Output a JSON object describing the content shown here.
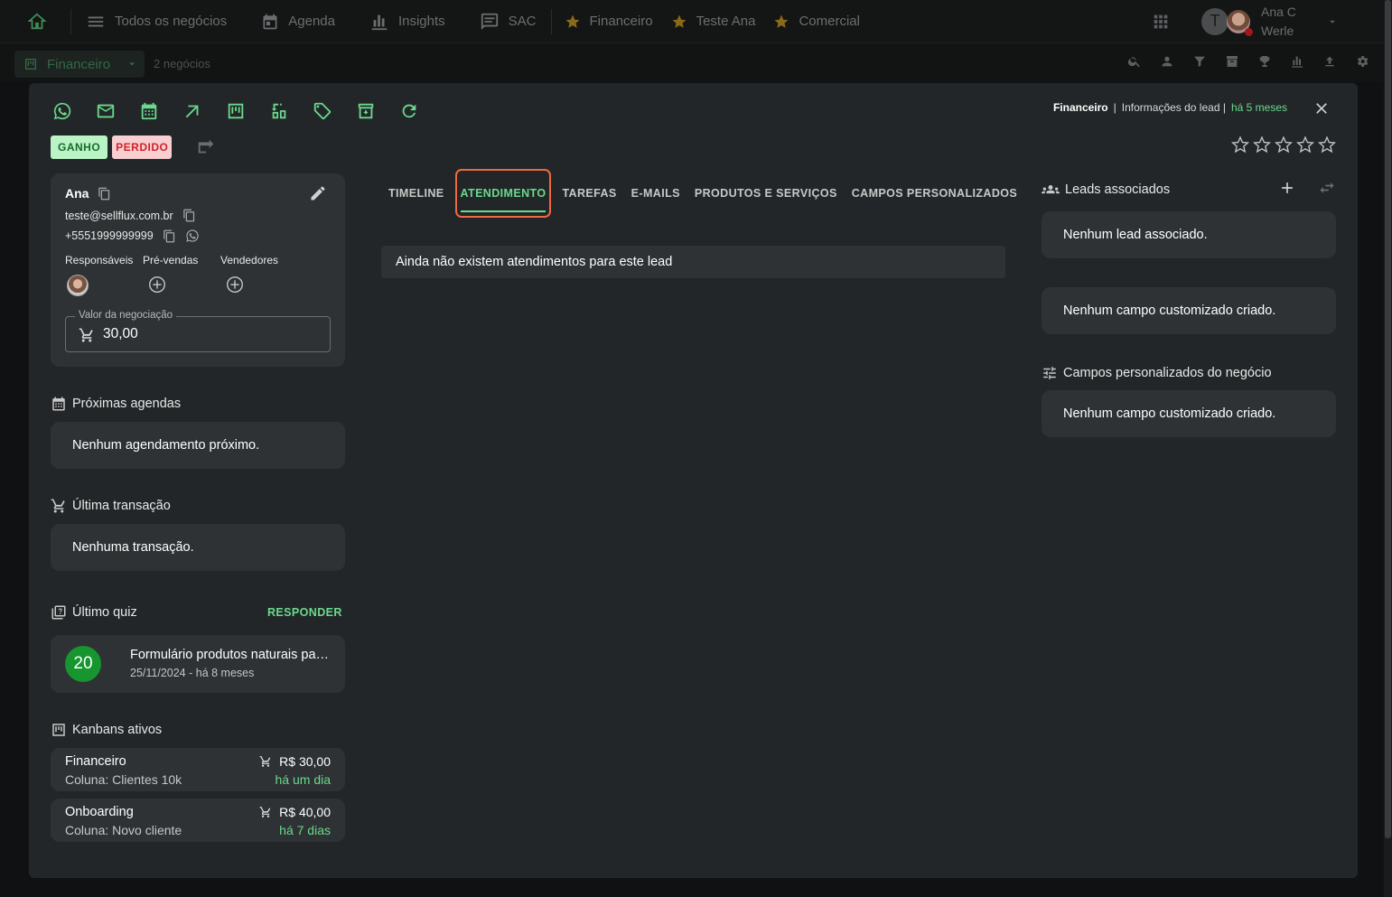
{
  "nav": {
    "items": [
      {
        "label": "Todos os negócios",
        "icon": "list-icon"
      },
      {
        "label": "Agenda",
        "icon": "calendar-icon"
      },
      {
        "label": "Insights",
        "icon": "bar-chart-icon"
      },
      {
        "label": "SAC",
        "icon": "chat-icon"
      },
      {
        "label": "Financeiro",
        "icon": "star-icon"
      },
      {
        "label": "Teste Ana",
        "icon": "star-icon"
      },
      {
        "label": "Comercial",
        "icon": "star-icon"
      }
    ],
    "avatar_letter": "T",
    "user_first": "Ana C",
    "user_last": "Werle"
  },
  "subbar": {
    "board": "Financeiro",
    "count": "2 negócios"
  },
  "header": {
    "board": "Financeiro",
    "separator": "|",
    "info": "Informações do lead |",
    "time": "há 5 meses"
  },
  "status": {
    "won": "GANHO",
    "lost": "PERDIDO"
  },
  "rating": {
    "stars": 5,
    "value": 0
  },
  "lead": {
    "name": "Ana",
    "email": "teste@sellflux.com.br",
    "phone": "+5551999999999",
    "roles": [
      "Responsáveis",
      "Pré-vendas",
      "Vendedores"
    ],
    "value_label": "Valor da negociação",
    "value": "30,00"
  },
  "agendas": {
    "title": "Próximas agendas",
    "empty": "Nenhum agendamento próximo."
  },
  "transaction": {
    "title": "Última transação",
    "empty": "Nenhuma transação."
  },
  "quiz": {
    "title": "Último quiz",
    "action": "RESPONDER",
    "score": "20",
    "name": "Formulário produtos naturais para saúde",
    "date": "25/11/2024 - há 8 meses"
  },
  "kanbans": {
    "title": "Kanbans ativos",
    "items": [
      {
        "name": "Financeiro",
        "column": "Coluna: Clientes 10k",
        "value": "R$ 30,00",
        "time": "há um dia"
      },
      {
        "name": "Onboarding",
        "column": "Coluna: Novo cliente",
        "value": "R$ 40,00",
        "time": "há 7 dias"
      }
    ]
  },
  "tabs": [
    "TIMELINE",
    "ATENDIMENTO",
    "TAREFAS",
    "E-MAILS",
    "PRODUTOS E SERVIÇOS",
    "CAMPOS PERSONALIZADOS"
  ],
  "active_tab": "ATENDIMENTO",
  "atendimento": {
    "empty": "Ainda não existem atendimentos para este lead"
  },
  "associated": {
    "title": "Leads associados",
    "empty": "Nenhum lead associado."
  },
  "custom_fields": {
    "empty": "Nenhum campo customizado criado."
  },
  "business_fields": {
    "title": "Campos personalizados do negócio",
    "empty": "Nenhum campo customizado criado."
  },
  "colors": {
    "accent": "#6ad98c",
    "highlight": "#ee6a3f",
    "won_bg": "#b9f3c6",
    "lost_bg": "#f8cfd0",
    "panel": "#2e3234",
    "modal": "#232628"
  }
}
